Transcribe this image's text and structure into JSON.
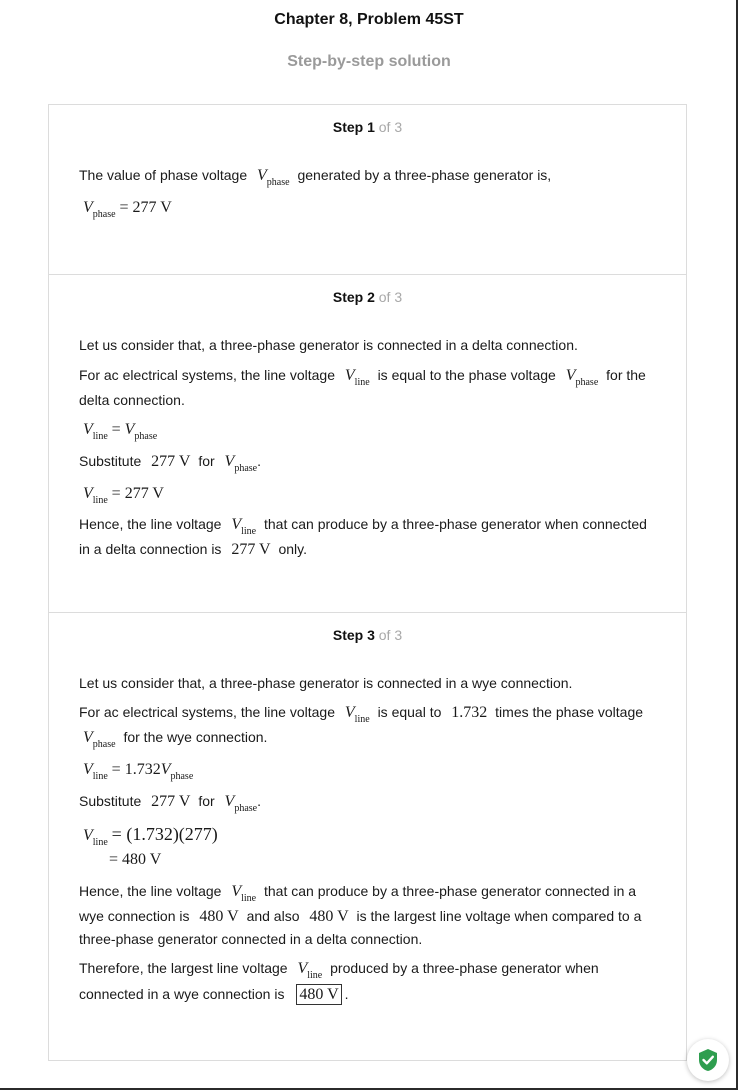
{
  "header": {
    "title": "Chapter 8, Problem 45ST",
    "subtitle": "Step-by-step solution"
  },
  "steps": [
    {
      "label": "Step 1",
      "of": "of 3",
      "lines": {
        "l1_text": "The value of phase voltage",
        "l1_tail": "generated by a three-phase generator is,",
        "eq1": "= 277 V"
      }
    },
    {
      "label": "Step 2",
      "of": "of 3",
      "lines": {
        "l1": "Let us consider that, a three-phase generator is connected in a delta connection.",
        "l2_a": "For ac electrical systems, the line voltage",
        "l2_b": "is equal to the phase voltage",
        "l2_c": "for the",
        "l3": "delta connection.",
        "eq_eq": "=",
        "sub_a": "Substitute",
        "sub_val": "277 V",
        "sub_for": "for",
        "sub_end": ".",
        "eq2": "= 277 V",
        "h1_a": "Hence, the line voltage",
        "h1_b": "that can produce by a three-phase generator when connected",
        "h2_a": "in a delta connection is",
        "h2_val": "277 V",
        "h2_b": "only."
      }
    },
    {
      "label": "Step 3",
      "of": "of 3",
      "lines": {
        "l1": "Let us consider that, a three-phase generator is connected in a wye connection.",
        "l2_a": "For ac electrical systems, the line voltage",
        "l2_b": "is equal to",
        "l2_num": "1.732",
        "l2_c": "times the phase voltage",
        "l3_b": "for the wye connection.",
        "eq1": "= 1.732",
        "sub_a": "Substitute",
        "sub_val": "277 V",
        "sub_for": "for",
        "sub_end": ".",
        "eq2": "= (1.732)(277)",
        "eq3": "= 480 V",
        "h1_a": "Hence, the line voltage",
        "h1_b": "that can produce by a three-phase generator connected in a",
        "h2_a": "wye connection is",
        "h2_val": "480 V",
        "h2_b": "and also",
        "h2_val2": "480 V",
        "h2_c": "is the largest line voltage when compared to a",
        "h3": "three-phase generator connected in a delta connection.",
        "t1_a": "Therefore, the largest line voltage",
        "t1_b": "produced by a three-phase generator when",
        "t2_a": "connected in a wye connection is",
        "t2_val": "480 V",
        "t2_end": "."
      }
    }
  ],
  "symbols": {
    "V": "V",
    "phase": "phase",
    "line": "line"
  },
  "badge": {
    "icon": "shield-check-icon",
    "color": "#2e9e4f"
  }
}
